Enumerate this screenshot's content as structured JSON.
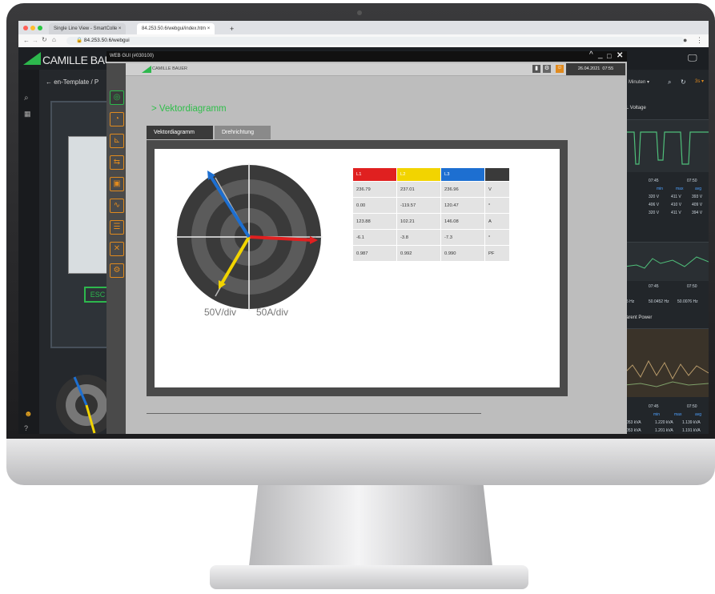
{
  "browser": {
    "tab1": "Single Line View - SmartColle",
    "tab2": "84.253.50.6/webgui/index.htm",
    "url": "84.253.50.6/webgui"
  },
  "app": {
    "logo": "CAMILLE BAUE",
    "breadcrumb": "en-Template / P",
    "esc_label": "ESC",
    "right_panel": {
      "time_select": "5 Minuten",
      "voltage_title": "L Voltage",
      "power_title": "arent Power",
      "t1": "07:45",
      "t2": "07:50",
      "hdr_min": "min",
      "hdr_max": "max",
      "hdr_avg": "avg",
      "v_rows": [
        [
          "320 V",
          "411 V",
          "393 V"
        ],
        [
          "406 V",
          "410 V",
          "409 V"
        ],
        [
          "320 V",
          "411 V",
          "394 V"
        ]
      ],
      "f_row": [
        "5 Hz",
        "50.0452 Hz",
        "50.0076 Hz"
      ],
      "p_rows": [
        [
          "053 kVA",
          "1.220 kVA",
          "1.139 kVA"
        ],
        [
          "053 kVA",
          "1.201 kVA",
          "1.191 kVA"
        ]
      ]
    }
  },
  "modal": {
    "window_title": "WEB GUI (#030100)",
    "brand": "CAMILLE BAUER",
    "date": "26.04.2021",
    "time": "07:55",
    "header": "> Vektordiagramm",
    "tabs": [
      "Vektordiagramm",
      "Drehrichtung"
    ],
    "scale_voltage": "50V/div",
    "scale_current": "50A/div"
  },
  "phasor_table": {
    "headers": [
      "L1",
      "L2",
      "L3",
      ""
    ],
    "header_colors": [
      "#e02020",
      "#f2d400",
      "#1d6fd1",
      "#3a3a3a"
    ],
    "rows": [
      [
        "236.79",
        "237.01",
        "236.96",
        "V"
      ],
      [
        "0.00",
        "-119.57",
        "120.47",
        "°"
      ],
      [
        "123.88",
        "102.21",
        "146.08",
        "A"
      ],
      [
        "-6.1",
        "-3.8",
        "-7.3",
        "°"
      ],
      [
        "0.987",
        "0.992",
        "0.990",
        "PF"
      ]
    ]
  }
}
